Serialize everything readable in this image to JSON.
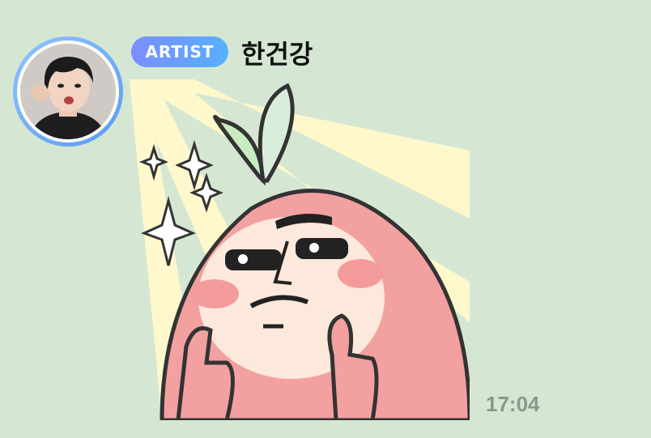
{
  "message": {
    "badge_label": "ARTIST",
    "sender_name": "한건강",
    "timestamp": "17:04",
    "avatar": {
      "icon": "profile-photo",
      "ring_color": "#6aa9f5"
    },
    "sticker": {
      "icon": "peach-character-thumbs-up-sticker"
    }
  },
  "colors": {
    "background": "#d5e7d3",
    "badge_gradient_start": "#7b8dff",
    "badge_gradient_end": "#57b0ff",
    "timestamp": "#8c978c"
  }
}
